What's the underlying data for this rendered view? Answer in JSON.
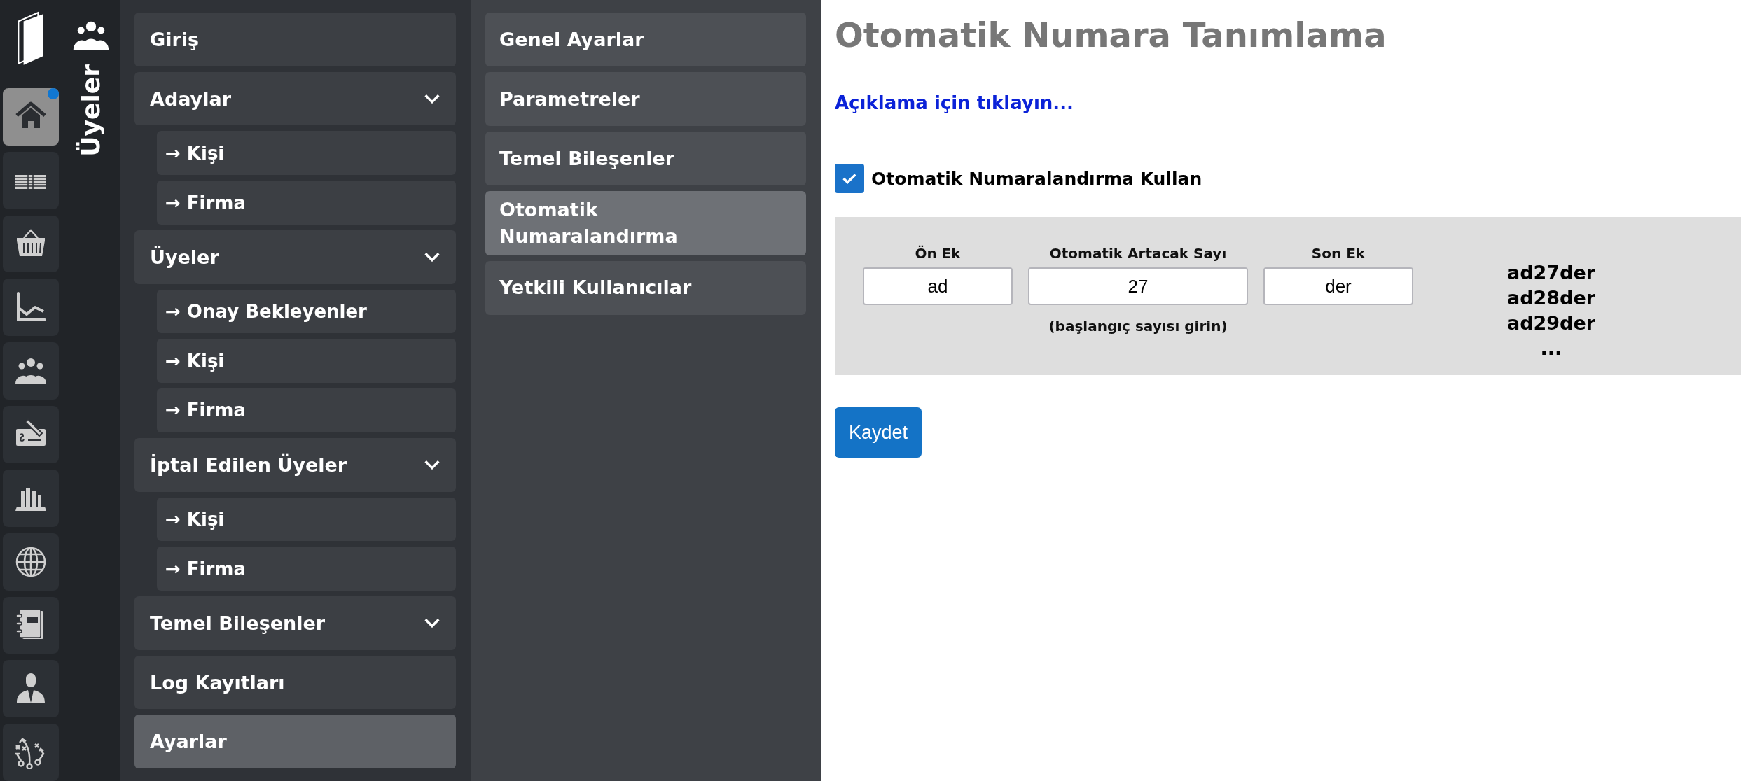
{
  "rail": [
    {
      "selected": true,
      "badge": true
    },
    {
      "selected": false,
      "badge": false
    },
    {
      "selected": false,
      "badge": false
    },
    {
      "selected": false,
      "badge": false
    },
    {
      "selected": false,
      "badge": false
    },
    {
      "selected": false,
      "badge": false
    },
    {
      "selected": false,
      "badge": false
    },
    {
      "selected": false,
      "badge": false
    },
    {
      "selected": false,
      "badge": false
    },
    {
      "selected": false,
      "badge": false
    },
    {
      "selected": false,
      "badge": false
    }
  ],
  "section_title": "Üyeler",
  "sidebar": {
    "items": [
      {
        "label": "Giriş",
        "selected": false
      },
      {
        "label": "Adaylar",
        "selected": false,
        "expanded": true,
        "children": [
          {
            "label": "→ Kişi",
            "selected": false
          },
          {
            "label": "→ Firma",
            "selected": false
          }
        ]
      },
      {
        "label": "Üyeler",
        "selected": false,
        "expanded": true,
        "children": [
          {
            "label": "→ Onay Bekleyenler",
            "selected": false
          },
          {
            "label": "→ Kişi",
            "selected": false
          },
          {
            "label": "→ Firma",
            "selected": false
          }
        ]
      },
      {
        "label": "İptal Edilen Üyeler",
        "selected": false,
        "expanded": true,
        "children": [
          {
            "label": "→ Kişi",
            "selected": false
          },
          {
            "label": "→ Firma",
            "selected": false
          }
        ]
      },
      {
        "label": "Temel Bileşenler",
        "selected": false,
        "expanded": true
      },
      {
        "label": "Log Kayıtları",
        "selected": false
      },
      {
        "label": "Ayarlar",
        "selected": true
      }
    ]
  },
  "submenu": {
    "items": [
      {
        "label": "Genel Ayarlar",
        "selected": false
      },
      {
        "label": "Parametreler",
        "selected": false
      },
      {
        "label": "Temel Bileşenler",
        "selected": false
      },
      {
        "label": "Otomatik Numaralandırma",
        "selected": true
      },
      {
        "label": "Yetkili Kullanıcılar",
        "selected": false
      }
    ]
  },
  "main": {
    "title": "Otomatik Numara Tanımlama",
    "help_link": "Açıklama için tıklayın...",
    "use_auto": {
      "label": "Otomatik Numaralandırma Kullan",
      "checked": true
    },
    "fields": [
      {
        "label": "Ön Ek",
        "value": "ad"
      },
      {
        "label": "Otomatik Artacak Sayı",
        "value": "27",
        "hint": "(başlangıç sayısı girin)"
      },
      {
        "label": "Son Ek",
        "value": "der"
      }
    ],
    "preview": [
      "ad27der",
      "ad28der",
      "ad29der",
      "..."
    ],
    "save_button": "Kaydet"
  }
}
